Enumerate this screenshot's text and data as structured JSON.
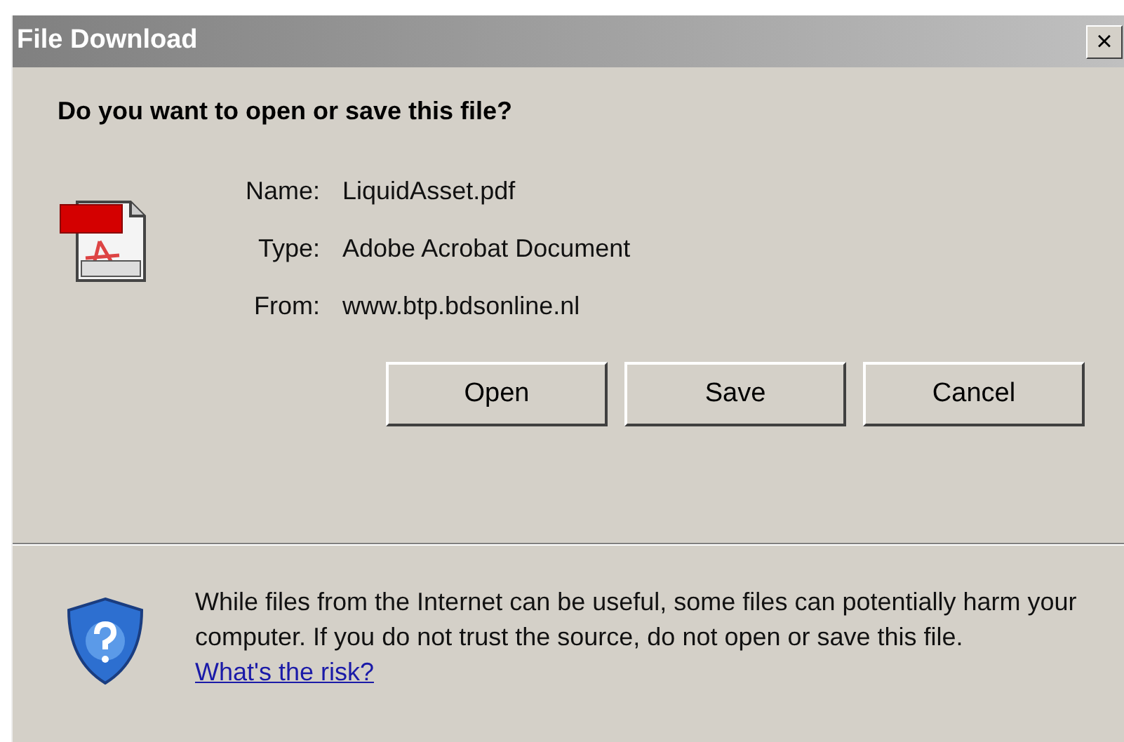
{
  "window": {
    "title": "File Download",
    "close": "×"
  },
  "heading": "Do you want to open or save this file?",
  "details": [
    {
      "label": "Name:",
      "value": "LiquidAsset.pdf"
    },
    {
      "label": "Type:",
      "value": "Adobe Acrobat Document"
    },
    {
      "label": "From:",
      "value": "www.btp.bdsonline.nl"
    }
  ],
  "buttons": [
    "Open",
    "Save",
    "Cancel"
  ],
  "warning": {
    "text": "While files from the Internet can be useful, some files can potentially harm your computer. If you do not trust the source, do not open or save this file.",
    "link": "What's the risk?"
  }
}
